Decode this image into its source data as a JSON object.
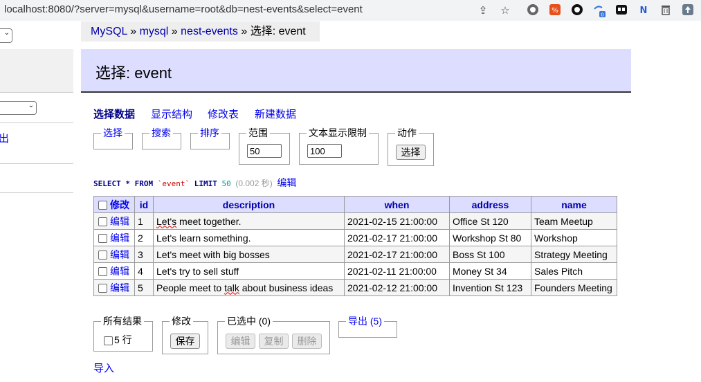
{
  "browser": {
    "url": "localhost:8080/?server=mysql&username=root&db=nest-events&select=event",
    "icons": [
      "share-icon",
      "star-icon",
      "extension-icon",
      "extension-icon",
      "extension-icon",
      "extension-icon",
      "extension-icon",
      "extension-icon",
      "extension-icon",
      "extension-icon"
    ],
    "badge": "0"
  },
  "sidebar": {
    "logout_label": "出"
  },
  "breadcrumb": {
    "items": [
      "MySQL",
      "mysql",
      "nest-events"
    ],
    "sep": "»",
    "current": "选择: event"
  },
  "page": {
    "title": "选择: event"
  },
  "tabs": [
    "选择数据",
    "显示结构",
    "修改表",
    "新建数据"
  ],
  "filters": {
    "select_label": "选择",
    "search_label": "搜索",
    "sort_label": "排序",
    "limit_label": "范围",
    "limit_value": "50",
    "text_length_label": "文本显示限制",
    "text_length_value": "100",
    "action_label": "动作",
    "action_button": "选择"
  },
  "sql": {
    "select_kw": "SELECT",
    "star": "*",
    "from_kw": "FROM",
    "table": "`event`",
    "limit_kw": "LIMIT",
    "limit_val": "50",
    "time": "(0.002 秒)",
    "edit_label": "编辑"
  },
  "table": {
    "header_modify": "修改",
    "columns": [
      "id",
      "description",
      "when",
      "address",
      "name"
    ],
    "edit_label": "编辑",
    "rows": [
      [
        "1",
        "Let's meet together.",
        "2021-02-15 21:00:00",
        "Office St 120",
        "Team Meetup"
      ],
      [
        "2",
        "Let's learn something.",
        "2021-02-17 21:00:00",
        "Workshop St 80",
        "Workshop"
      ],
      [
        "3",
        "Let's meet with big bosses",
        "2021-02-17 21:00:00",
        "Boss St 100",
        "Strategy Meeting"
      ],
      [
        "4",
        "Let's try to sell stuff",
        "2021-02-11 21:00:00",
        "Money St 34",
        "Sales Pitch"
      ],
      [
        "5",
        "People meet to talk about business ideas",
        "2021-02-12 21:00:00",
        "Invention St 123",
        "Founders Meeting"
      ]
    ]
  },
  "bottom": {
    "all_results_label": "所有结果",
    "rows_count": "5 行",
    "modify_label": "修改",
    "save_button": "保存",
    "selected_label": "已选中 (0)",
    "edit_button": "编辑",
    "copy_button": "复制",
    "delete_button": "删除",
    "export_label": "导出 (5)",
    "import_label": "导入"
  }
}
